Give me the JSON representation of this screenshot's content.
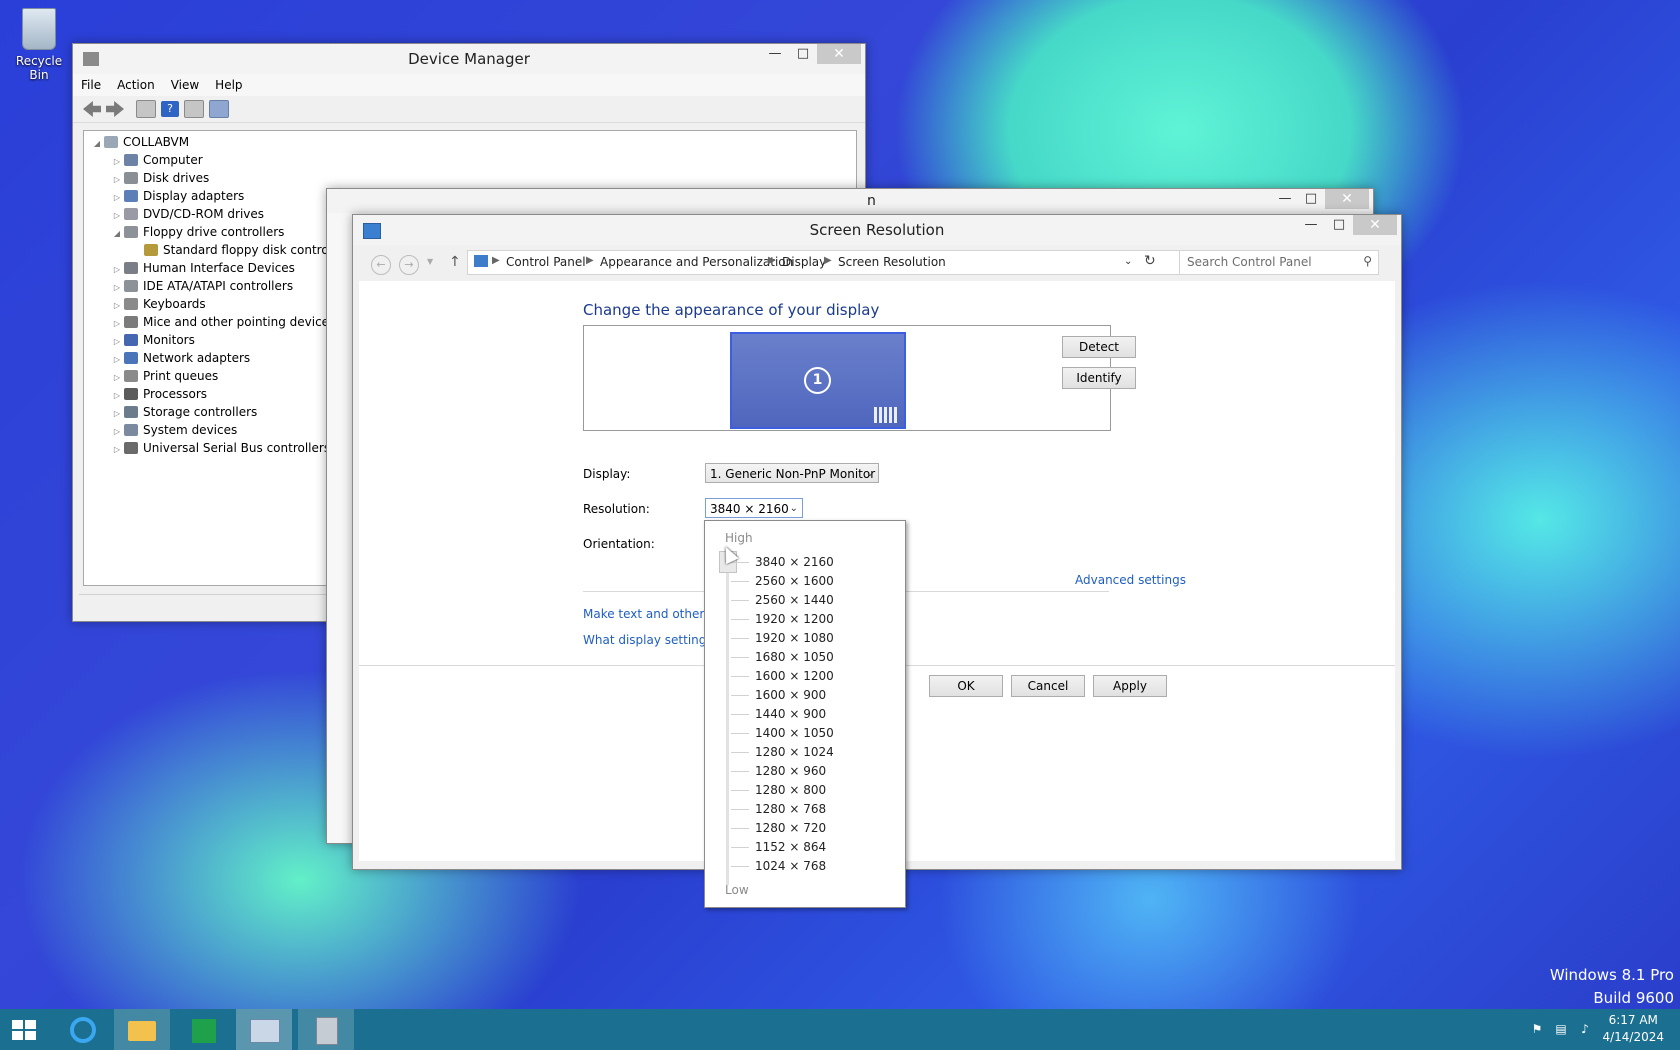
{
  "desktop": {
    "recycle_bin_label": "Recycle Bin"
  },
  "watermark": {
    "line1": "Windows 8.1 Pro",
    "line2": "Build 9600"
  },
  "device_manager": {
    "title": "Device Manager",
    "menu": [
      "File",
      "Action",
      "View",
      "Help"
    ],
    "root": "COLLABVM",
    "nodes": [
      {
        "label": "Computer",
        "expanded": false
      },
      {
        "label": "Disk drives",
        "expanded": false
      },
      {
        "label": "Display adapters",
        "expanded": false
      },
      {
        "label": "DVD/CD-ROM drives",
        "expanded": false
      },
      {
        "label": "Floppy drive controllers",
        "expanded": true
      },
      {
        "label": "Standard floppy disk controller",
        "child": true
      },
      {
        "label": "Human Interface Devices",
        "expanded": false
      },
      {
        "label": "IDE ATA/ATAPI controllers",
        "expanded": false
      },
      {
        "label": "Keyboards",
        "expanded": false
      },
      {
        "label": "Mice and other pointing devices",
        "expanded": false
      },
      {
        "label": "Monitors",
        "expanded": false
      },
      {
        "label": "Network adapters",
        "expanded": false
      },
      {
        "label": "Print queues",
        "expanded": false
      },
      {
        "label": "Processors",
        "expanded": false
      },
      {
        "label": "Storage controllers",
        "expanded": false
      },
      {
        "label": "System devices",
        "expanded": false
      },
      {
        "label": "Universal Serial Bus controllers",
        "expanded": false
      }
    ]
  },
  "behind_window": {
    "title_fragment": "n"
  },
  "screen_resolution": {
    "title": "Screen Resolution",
    "breadcrumb": [
      "Control Panel",
      "Appearance and Personalization",
      "Display",
      "Screen Resolution"
    ],
    "search_placeholder": "Search Control Panel",
    "heading": "Change the appearance of your display",
    "monitor_number": "1",
    "detect_label": "Detect",
    "identify_label": "Identify",
    "display_label": "Display:",
    "display_value": "1. Generic Non-PnP Monitor",
    "resolution_label": "Resolution:",
    "resolution_value": "3840 × 2160",
    "orientation_label": "Orientation:",
    "advanced_link": "Advanced settings",
    "link_text_size": "Make text and other",
    "link_what_settings": "What display setting",
    "ok_label": "OK",
    "cancel_label": "Cancel",
    "apply_label": "Apply"
  },
  "resolution_dropdown": {
    "high_label": "High",
    "low_label": "Low",
    "selected_index": 0,
    "options": [
      "3840 × 2160",
      "2560 × 1600",
      "2560 × 1440",
      "1920 × 1200",
      "1920 × 1080",
      "1680 × 1050",
      "1600 × 1200",
      "1600 × 900",
      "1440 × 900",
      "1400 × 1050",
      "1280 × 1024",
      "1280 × 960",
      "1280 × 800",
      "1280 × 768",
      "1280 × 720",
      "1152 × 864",
      "1024 × 768"
    ]
  },
  "taskbar": {
    "time": "6:17 AM",
    "date": "4/14/2024",
    "color": "#1b6f90"
  }
}
